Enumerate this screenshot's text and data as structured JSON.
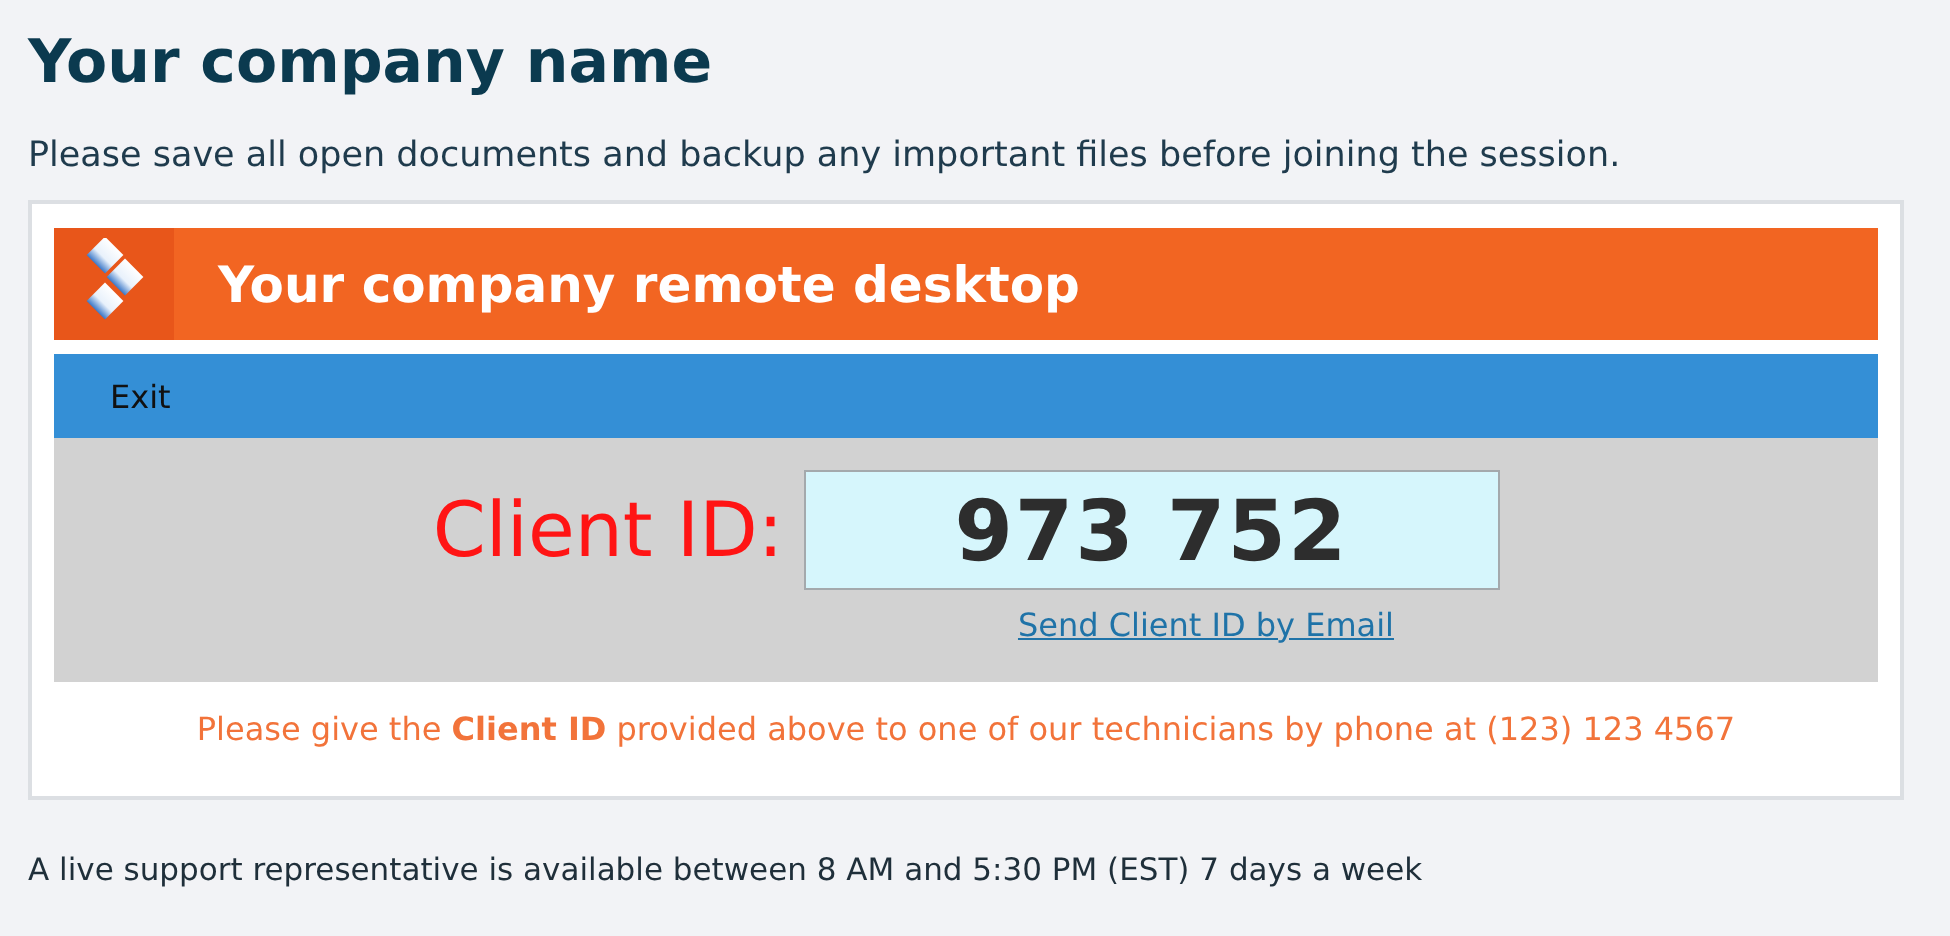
{
  "heading": "Your company name",
  "intro": "Please save all open documents and backup any important files before joining the session.",
  "panel": {
    "title": "Your company remote desktop",
    "menu": [
      {
        "label": "Exit"
      }
    ],
    "client_id_label": "Client ID:",
    "client_id": "973 752",
    "email_link": "Send Client ID by Email",
    "note": "Please give the **Client ID** provided above to one of our technicians by phone at (123) 123 4567"
  },
  "footer": "A live support representative is available between 8 AM and 5:30 PM (EST) 7 days a week"
}
